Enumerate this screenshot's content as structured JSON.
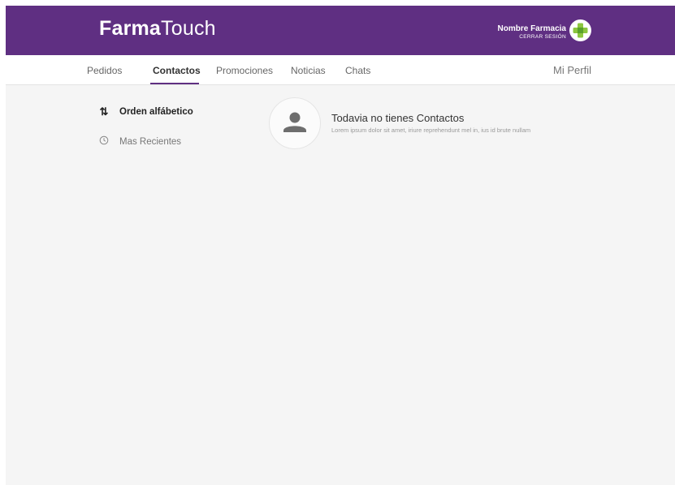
{
  "header": {
    "logo_bold": "Farma",
    "logo_light": "Touch",
    "pharmacy_name": "Nombre Farmacia",
    "logout_label": "CERRAR SESIÓN"
  },
  "nav": {
    "items": [
      {
        "label": "Pedidos",
        "active": false
      },
      {
        "label": "Contactos",
        "active": true
      },
      {
        "label": "Promociones",
        "active": false
      },
      {
        "label": "Noticias",
        "active": false
      },
      {
        "label": "Chats",
        "active": false
      }
    ],
    "profile_label": "Mi Perfil"
  },
  "sidebar": {
    "sort_alpha": {
      "label": "Orden alfábetico",
      "icon": "sort-arrows-icon"
    },
    "sort_recent": {
      "label": "Mas Recientes",
      "icon": "clock-icon"
    }
  },
  "empty_state": {
    "title": "Todavia no tienes Contactos",
    "subtitle": "Lorem ipsum dolor sit amet, iriure reprehendunt mel in, ius id brute nullam",
    "icon": "person-icon"
  },
  "colors": {
    "brand_purple": "#5f2f82",
    "cross_green": "#8cc63f",
    "background": "#f5f5f5"
  }
}
